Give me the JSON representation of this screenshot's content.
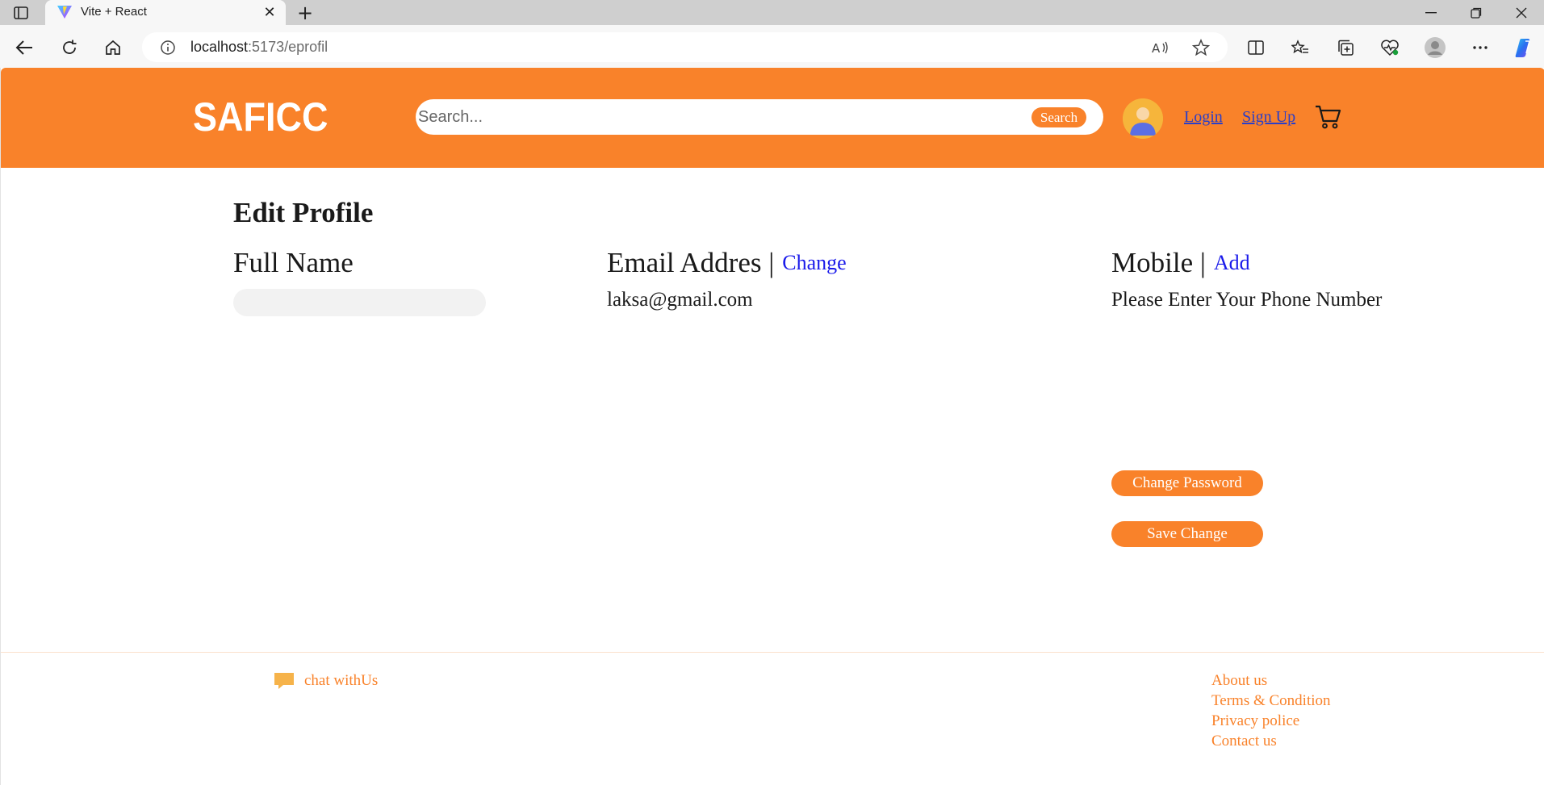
{
  "browser": {
    "tab_title": "Vite + React",
    "url_host": "localhost",
    "url_path": ":5173/eprofil"
  },
  "header": {
    "logo": "SAFICC",
    "search_placeholder": "Search...",
    "search_button": "Search",
    "login": "Login",
    "signup": "Sign Up"
  },
  "main": {
    "title": "Edit Profile",
    "full_name_label": "Full Name",
    "full_name_value": "",
    "email_label": "Email Addres |",
    "email_action": "Change",
    "email_value": "laksa@gmail.com",
    "mobile_label": "Mobile |",
    "mobile_action": "Add",
    "mobile_value": "Please Enter Your Phone Number",
    "change_password": "Change Password",
    "save_change": "Save Change"
  },
  "footer": {
    "chat": "chat withUs",
    "links": [
      "About us",
      "Terms & Condition",
      "Privacy police",
      "Contact us"
    ]
  },
  "colors": {
    "brand": "#f9822a",
    "link": "#2a3ec8",
    "action_link": "#1a1aea"
  },
  "icons": {
    "cart": "cart-icon",
    "chat": "chat-bubble-icon",
    "avatar": "user-avatar"
  }
}
